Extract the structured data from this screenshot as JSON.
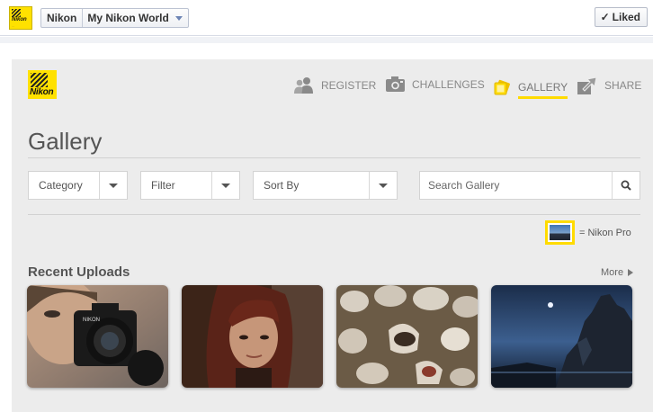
{
  "topbar": {
    "page_name": "Nikon",
    "app_name": "My Nikon World",
    "liked_label": "Liked",
    "liked_check": "✓"
  },
  "brand": {
    "logo_text": "Nikon",
    "accent_color": "#ffdb00"
  },
  "nav": {
    "items": [
      {
        "label": "REGISTER",
        "icon": "users-icon"
      },
      {
        "label": "CHALLENGES",
        "icon": "camera-icon"
      },
      {
        "label": "GALLERY",
        "icon": "photos-icon",
        "active": true
      },
      {
        "label": "SHARE",
        "icon": "share-icon"
      }
    ]
  },
  "gallery": {
    "title": "Gallery",
    "filters": {
      "category": "Category",
      "filter": "Filter",
      "sort": "Sort By"
    },
    "search_placeholder": "Search Gallery",
    "pro_legend": "= Nikon Pro"
  },
  "recent": {
    "title": "Recent Uploads",
    "more_label": "More",
    "photos": [
      {
        "subject": "man holding Nikon camera"
      },
      {
        "subject": "woman portrait"
      },
      {
        "subject": "hatched turtle eggs in sand"
      },
      {
        "subject": "moonlit rock formation"
      }
    ]
  }
}
